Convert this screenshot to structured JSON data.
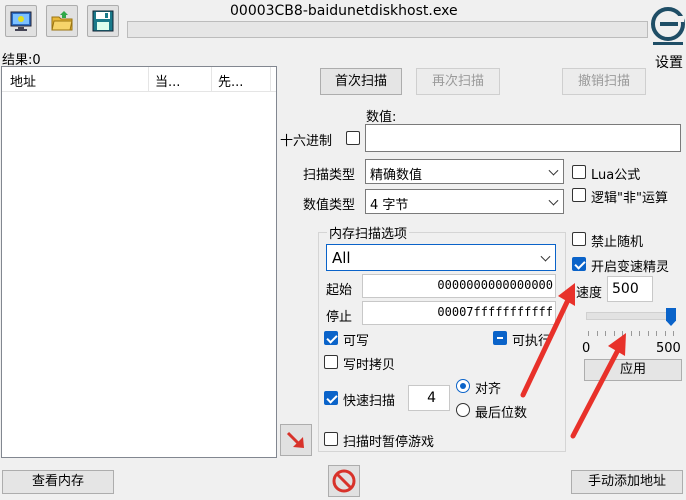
{
  "window": {
    "title": "00003CB8-baidunetdiskhost.exe"
  },
  "toolbar": {
    "open_process_icon": "computer-icon",
    "open_file_icon": "folder-icon",
    "save_icon": "floppy-disk-icon"
  },
  "settings": {
    "label": "设置"
  },
  "results": {
    "count_label": "结果:0",
    "columns": [
      "地址",
      "当...",
      "先..."
    ]
  },
  "scan_buttons": {
    "first": "首次扫描",
    "next": "再次扫描",
    "undo": "撤销扫描"
  },
  "value": {
    "label": "数值:",
    "hex_label": "十六进制",
    "input": ""
  },
  "scan_type": {
    "label": "扫描类型",
    "selected": "精确数值"
  },
  "value_type": {
    "label": "数值类型",
    "selected": "4 字节"
  },
  "options_right": {
    "lua": "Lua公式",
    "not_logic": "逻辑\"非\"运算"
  },
  "memory_scan": {
    "title": "内存扫描选项",
    "region": "All",
    "start_label": "起始",
    "start_value": "0000000000000000",
    "stop_label": "停止",
    "stop_value": "00007fffffffffff",
    "writable": "可写",
    "executable": "可执行",
    "copy_on_write": "写时拷贝",
    "fast_scan": "快速扫描",
    "fast_scan_value": "4",
    "align": "对齐",
    "last_digits": "最后位数",
    "pause_game": "扫描时暂停游戏"
  },
  "speedhack": {
    "disable_random": "禁止随机",
    "enable_speedhack": "开启变速精灵",
    "speed_label": "速度",
    "speed_value": "500",
    "slider_min": "0",
    "slider_max": "500",
    "slider_level": 1.0,
    "apply": "应用"
  },
  "bottom": {
    "view_memory": "查看内存",
    "add_address": "手动添加地址"
  },
  "colors": {
    "accent": "#0a63c9",
    "annotation_arrow": "#e8312a",
    "logo": "#1f4e66"
  }
}
